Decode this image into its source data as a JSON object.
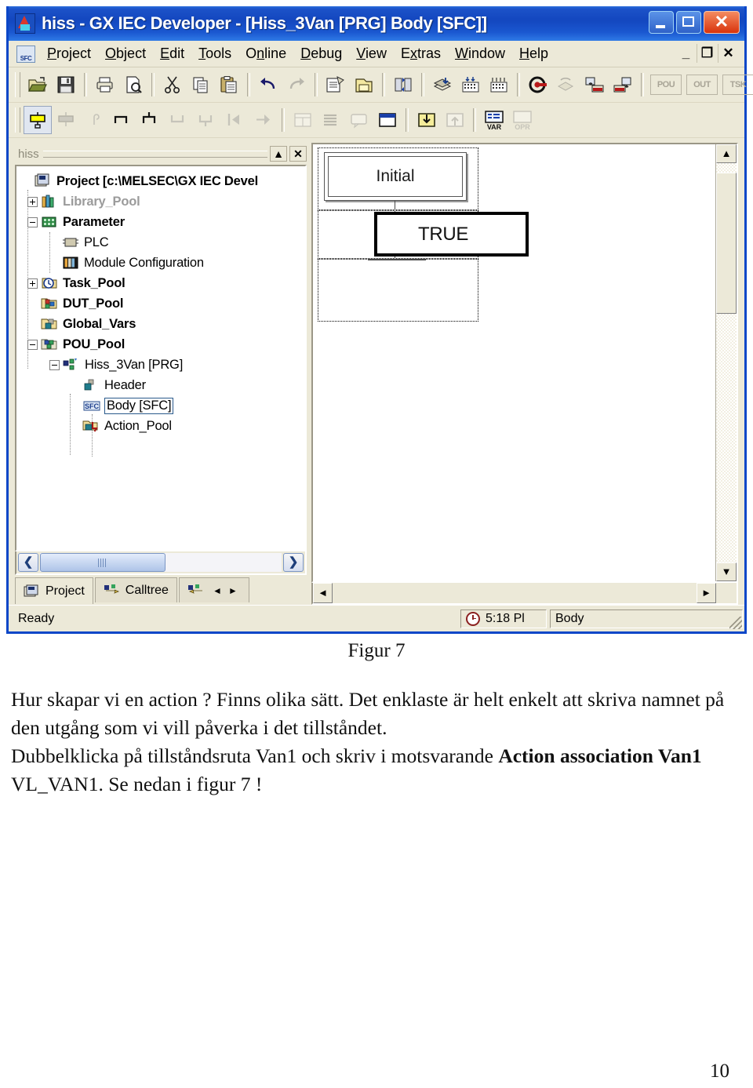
{
  "window": {
    "title": "hiss - GX IEC Developer - [Hiss_3Van [PRG] Body [SFC]]",
    "app_icon": "melsec-app-icon",
    "controls": {
      "minimize": "_",
      "maximize": "□",
      "close": "✕"
    },
    "mdi_controls": {
      "minimize": "_",
      "restore": "❐",
      "close": "✕"
    }
  },
  "menubar": {
    "doc_icon": "sfc-document-icon",
    "items": [
      {
        "label": "Project",
        "accel": "P"
      },
      {
        "label": "Object",
        "accel": "O"
      },
      {
        "label": "Edit",
        "accel": "E"
      },
      {
        "label": "Tools",
        "accel": "T"
      },
      {
        "label": "Online",
        "accel": "n"
      },
      {
        "label": "Debug",
        "accel": "D"
      },
      {
        "label": "View",
        "accel": "V"
      },
      {
        "label": "Extras",
        "accel": "x"
      },
      {
        "label": "Window",
        "accel": "W"
      },
      {
        "label": "Help",
        "accel": "H"
      }
    ]
  },
  "toolbar_main": {
    "buttons": [
      {
        "name": "open-project-icon",
        "enabled": true
      },
      {
        "name": "save-icon",
        "enabled": true
      },
      {
        "name": "print-icon",
        "enabled": true
      },
      {
        "name": "print-preview-icon",
        "enabled": true
      },
      {
        "name": "cut-icon",
        "enabled": true
      },
      {
        "name": "copy-icon",
        "enabled": true
      },
      {
        "name": "paste-icon",
        "enabled": true
      },
      {
        "name": "undo-icon",
        "enabled": true
      },
      {
        "name": "redo-icon",
        "enabled": false
      },
      {
        "name": "new-object-icon",
        "enabled": true
      },
      {
        "name": "open-object-icon",
        "enabled": true
      },
      {
        "name": "transfer-icon",
        "enabled": true
      },
      {
        "name": "build-icon",
        "enabled": true
      },
      {
        "name": "rebuild-all-icon",
        "enabled": true
      },
      {
        "name": "compile-icon",
        "enabled": true
      },
      {
        "name": "monitor-mode-icon",
        "enabled": true
      },
      {
        "name": "refresh-monitor-icon",
        "enabled": false
      },
      {
        "name": "download-plc-icon",
        "enabled": true
      },
      {
        "name": "upload-plc-icon",
        "enabled": true
      }
    ],
    "tag_buttons": [
      {
        "label": "POU",
        "enabled": false
      },
      {
        "label": "OUT",
        "enabled": false
      },
      {
        "label": "TSK",
        "enabled": false
      }
    ]
  },
  "toolbar_sfc": {
    "buttons": [
      {
        "name": "sfc-step-icon",
        "enabled": true,
        "active": true
      },
      {
        "name": "sfc-transition-icon",
        "enabled": false
      },
      {
        "name": "sfc-jump-icon",
        "enabled": false
      },
      {
        "name": "sfc-branch-right-icon",
        "enabled": true
      },
      {
        "name": "sfc-branch-left-icon",
        "enabled": true
      },
      {
        "name": "sfc-simult-divergence-icon",
        "enabled": false
      },
      {
        "name": "sfc-simult-convergence-icon",
        "enabled": false
      },
      {
        "name": "sfc-previous-icon",
        "enabled": false
      },
      {
        "name": "sfc-next-icon",
        "enabled": false
      },
      {
        "name": "action-block-icon",
        "enabled": false
      },
      {
        "name": "list-view-icon",
        "enabled": false
      },
      {
        "name": "comment-icon",
        "enabled": false
      },
      {
        "name": "window-body-icon",
        "enabled": true
      },
      {
        "name": "import-icon",
        "enabled": true
      },
      {
        "name": "export-icon",
        "enabled": false
      },
      {
        "name": "variable-list-icon",
        "enabled": true,
        "label": "VAR"
      },
      {
        "name": "operator-list-icon",
        "enabled": false,
        "label": "OPR"
      }
    ]
  },
  "tree_panel": {
    "title": "hiss",
    "minimize_glyph": "▲",
    "close_glyph": "✕",
    "nodes": [
      {
        "label": "Project [c:\\MELSEC\\GX IEC Devel",
        "icon": "project-root-icon",
        "expander": "none",
        "indent": 0,
        "bold": true
      },
      {
        "label": "Library_Pool",
        "icon": "library-pool-icon",
        "expander": "plus",
        "indent": 1,
        "gray": true
      },
      {
        "label": "Parameter",
        "icon": "parameter-icon",
        "expander": "minus",
        "indent": 1,
        "bold": true
      },
      {
        "label": "PLC",
        "icon": "plc-chip-icon",
        "expander": "none",
        "indent": 2
      },
      {
        "label": "Module Configuration",
        "icon": "module-config-icon",
        "expander": "none",
        "indent": 2
      },
      {
        "label": "Task_Pool",
        "icon": "task-pool-clock-icon",
        "expander": "plus",
        "indent": 1,
        "bold": true
      },
      {
        "label": "DUT_Pool",
        "icon": "dut-pool-icon",
        "expander": "none",
        "indent": 1,
        "bold": true
      },
      {
        "label": "Global_Vars",
        "icon": "global-vars-icon",
        "expander": "none",
        "indent": 1,
        "bold": true
      },
      {
        "label": "POU_Pool",
        "icon": "pou-pool-icon",
        "expander": "minus",
        "indent": 1,
        "bold": true
      },
      {
        "label": "Hiss_3Van [PRG]",
        "icon": "pou-program-icon",
        "expander": "minus",
        "indent": 2
      },
      {
        "label": "Header",
        "icon": "header-icon",
        "expander": "none",
        "indent": 3
      },
      {
        "label": "Body [SFC]",
        "icon": "sfc-body-icon",
        "expander": "none",
        "indent": 3,
        "selected": true
      },
      {
        "label": "Action_Pool",
        "icon": "action-pool-icon",
        "expander": "none",
        "indent": 3
      }
    ],
    "hscroll": {
      "left_glyph": "❮",
      "right_glyph": "❯"
    },
    "tabs": [
      {
        "label": "Project",
        "icon": "project-tab-icon",
        "selected": true
      },
      {
        "label": "Calltree",
        "icon": "calltree-tab-icon",
        "selected": false
      }
    ],
    "tab_nav": {
      "extra_icon": "usedby-tab-icon",
      "prev": "◄",
      "next": "►"
    }
  },
  "editor": {
    "step": {
      "label": "Initial",
      "type": "initial-step"
    },
    "transition": {
      "label": "TRUE",
      "type": "transition"
    },
    "vscroll": {
      "up_glyph": "▲",
      "down_glyph": "▼"
    },
    "hscroll": {
      "left_glyph": "◄",
      "right_glyph": "►"
    }
  },
  "statusbar": {
    "ready": "Ready",
    "clock_icon": "clock-icon",
    "time": "5:18 Pl",
    "context": "Body"
  },
  "document": {
    "figure_caption": "Figur 7",
    "paragraph1": "Hur skapar vi en action ? Finns olika sätt. Det enklaste är helt enkelt att skriva namnet på den utgång som vi vill påverka i det tillståndet.",
    "paragraph2_a": "Dubbelklicka på tillståndsruta Van1 och skriv i motsvarande ",
    "paragraph2_bold": "Action association Van1",
    "paragraph2_b": " VL_VAN1. Se nedan i figur 7 !",
    "page_number": "10"
  },
  "colors": {
    "titlebar_blue": "#1347bf",
    "window_border": "#0a46c8",
    "chrome": "#ece9d8",
    "accent_yellow": "#ffff00"
  }
}
